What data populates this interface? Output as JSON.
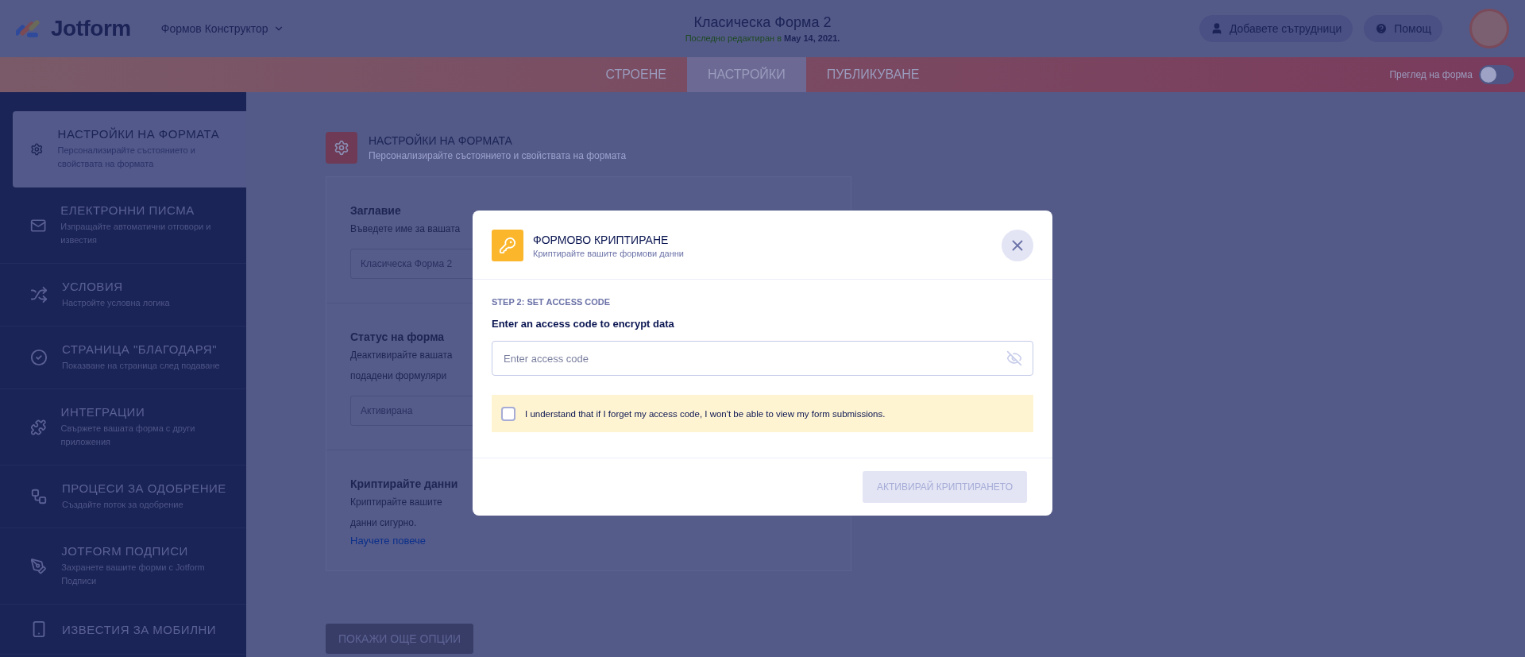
{
  "header": {
    "logo": "Jotform",
    "builder_menu": "Формов Конструктор",
    "form_title": "Класическа Форма 2",
    "last_edited": "Последно редактиран в **May 14, 2021.**",
    "buttons": [
      {
        "kind": "collaborators",
        "label": "Добавете сътрудници"
      },
      {
        "kind": "help",
        "label": "Помощ"
      }
    ]
  },
  "tabs": [
    {
      "label": "СТРОЕНЕ",
      "selected": false
    },
    {
      "label": "НАСТРОЙКИ",
      "selected": true
    },
    {
      "label": "ПУБЛИКУВАНЕ",
      "selected": false
    }
  ],
  "preview_toggle": {
    "label": "Преглед на форма",
    "on": false
  },
  "sidebar": {
    "items": [
      {
        "kind": "settings",
        "title": "НАСТРОЙКИ НА ФОРМАТА",
        "description": "Персонализирайте състоянието и свойствата на формата",
        "selected": true
      },
      {
        "kind": "mail",
        "title": "ЕЛЕКТРОННИ ПИСМА",
        "description": "Изпращайте автоматични отговори и известия",
        "selected": false
      },
      {
        "kind": "conditions",
        "title": "УСЛОВИЯ",
        "description": "Настройте условна логика",
        "selected": false
      },
      {
        "kind": "thankyou",
        "title": "СТРАНИЦА \"БЛАГОДАРЯ\"",
        "description": "Показване на страница след подаване",
        "selected": false
      },
      {
        "kind": "integrations",
        "title": "ИНТЕГРАЦИИ",
        "description": "Свържете вашата форма с други приложения",
        "selected": false
      },
      {
        "kind": "approval",
        "title": "ПРОЦЕСИ ЗА ОДОБРЕНИЕ",
        "description": "Създайте поток за одобрение",
        "selected": false
      },
      {
        "kind": "sign",
        "title": "JOTFORM ПОДПИСИ",
        "description": "Захранете вашите форми с Jotform Подписи",
        "selected": false
      },
      {
        "kind": "mobile",
        "title": "ИЗВЕСТИЯ ЗА МОБИЛНИ",
        "selected": false
      }
    ]
  },
  "section": {
    "title": "НАСТРОЙКИ НА ФОРМАТА",
    "subtitle": "Персонализирайте състоянието и свойствата на формата",
    "fields": [
      {
        "label": "Заглавие",
        "description": "Въведете име за вашата",
        "value": "Класическа Форма 2"
      },
      {
        "label": "Статус на форма",
        "description": "Деактивирайте вашата",
        "description_2": "подадени формуляри",
        "value": "Активирана"
      },
      {
        "label": "Криптирайте данни",
        "description": "Криптирайте вашите",
        "description_2": "данни сигурно.",
        "link": "Научете повече"
      }
    ],
    "more_button": "ПОКАЖИ ОЩЕ ОПЦИИ"
  },
  "dialog": {
    "title": "ФОРМОВО КРИПТИРАНЕ",
    "subtitle": "Криптирайте вашите формови данни",
    "step": "STEP 2: SET ACCESS CODE",
    "prompt": "Enter an access code to encrypt data",
    "input": {
      "placeholder": "Enter access code"
    },
    "consent": {
      "label": "I understand that if I forget my access code, I won't be able to view my form submissions.",
      "checked": false
    },
    "submit": {
      "label": "АКТИВИРАЙ КРИПТИРАНЕТО",
      "disabled": true
    }
  }
}
